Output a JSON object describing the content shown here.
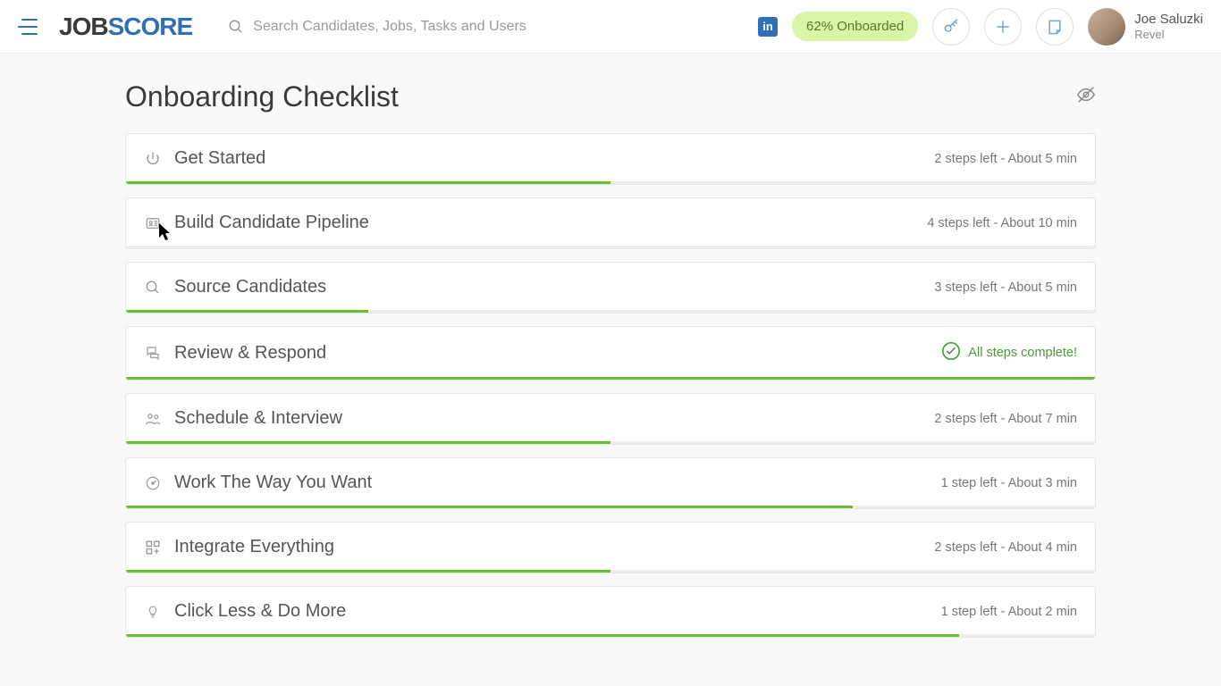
{
  "header": {
    "logo_a": "JOB",
    "logo_b": "SCORE",
    "search_placeholder": "Search Candidates, Jobs, Tasks and Users",
    "linkedin_label": "in",
    "onboard_label": "62% Onboarded",
    "user_name": "Joe Saluzki",
    "user_sub": "Revel"
  },
  "page": {
    "title": "Onboarding Checklist"
  },
  "items": [
    {
      "icon": "power",
      "title": "Get Started",
      "status": "2 steps left - About 5 min",
      "progress": 50,
      "complete": false
    },
    {
      "icon": "id-card",
      "title": "Build Candidate Pipeline",
      "status": "4 steps left - About 10 min",
      "progress": 0,
      "complete": false
    },
    {
      "icon": "search",
      "title": "Source Candidates",
      "status": "3 steps left - About 5 min",
      "progress": 25,
      "complete": false
    },
    {
      "icon": "chat",
      "title": "Review & Respond",
      "status": "All steps complete!",
      "progress": 100,
      "complete": true
    },
    {
      "icon": "people",
      "title": "Schedule & Interview",
      "status": "2 steps left - About 7 min",
      "progress": 50,
      "complete": false
    },
    {
      "icon": "gauge",
      "title": "Work The Way You Want",
      "status": "1 step left - About 3 min",
      "progress": 75,
      "complete": false
    },
    {
      "icon": "grid",
      "title": "Integrate Everything",
      "status": "2 steps left - About 4 min",
      "progress": 50,
      "complete": false
    },
    {
      "icon": "bulb",
      "title": "Click Less & Do More",
      "status": "1 step left - About 2 min",
      "progress": 86,
      "complete": false
    }
  ]
}
